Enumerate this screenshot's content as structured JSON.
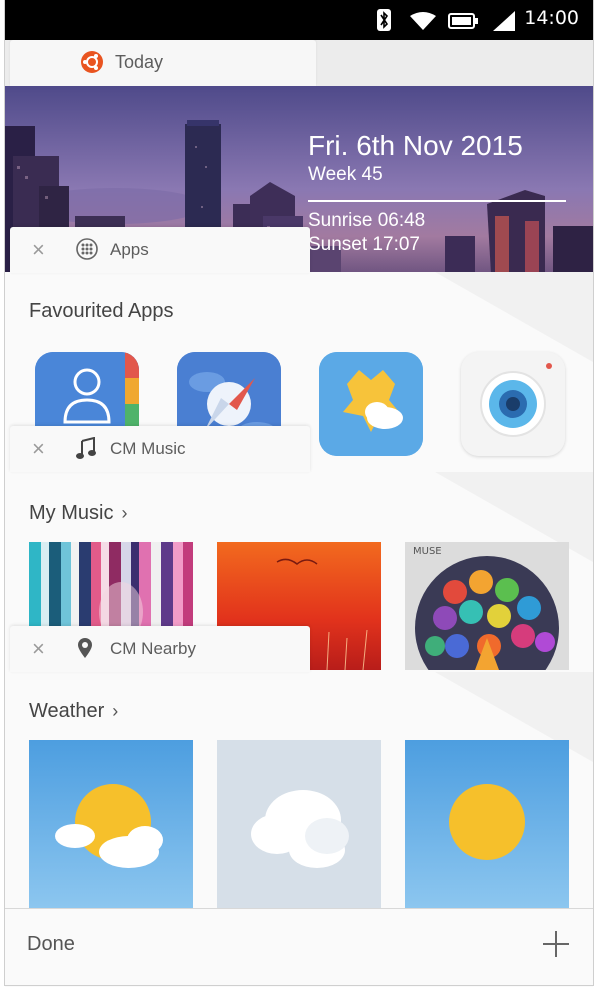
{
  "status": {
    "time": "14:00",
    "icons": [
      "bluetooth-icon",
      "wifi-icon",
      "battery-icon",
      "signal-icon"
    ]
  },
  "today": {
    "tab_label": "Today",
    "date": "Fri. 6th Nov 2015",
    "week": "Week 45",
    "sunrise": "Sunrise 06:48",
    "sunset": "Sunset 17:07"
  },
  "apps": {
    "tab_label": "Apps",
    "section": "Favourited Apps",
    "items": [
      "contacts-app-icon",
      "browser-app-icon",
      "weather-app-icon",
      "camera-app-icon"
    ]
  },
  "music": {
    "tab_label": "CM Music",
    "section": "My Music",
    "album3_text": "MUSE"
  },
  "nearby": {
    "tab_label": "CM Nearby",
    "section": "Weather"
  },
  "bottom": {
    "done_label": "Done"
  },
  "colors": {
    "accent": "#e95420",
    "sky": "#58a4de",
    "sun": "#f6c02b"
  }
}
